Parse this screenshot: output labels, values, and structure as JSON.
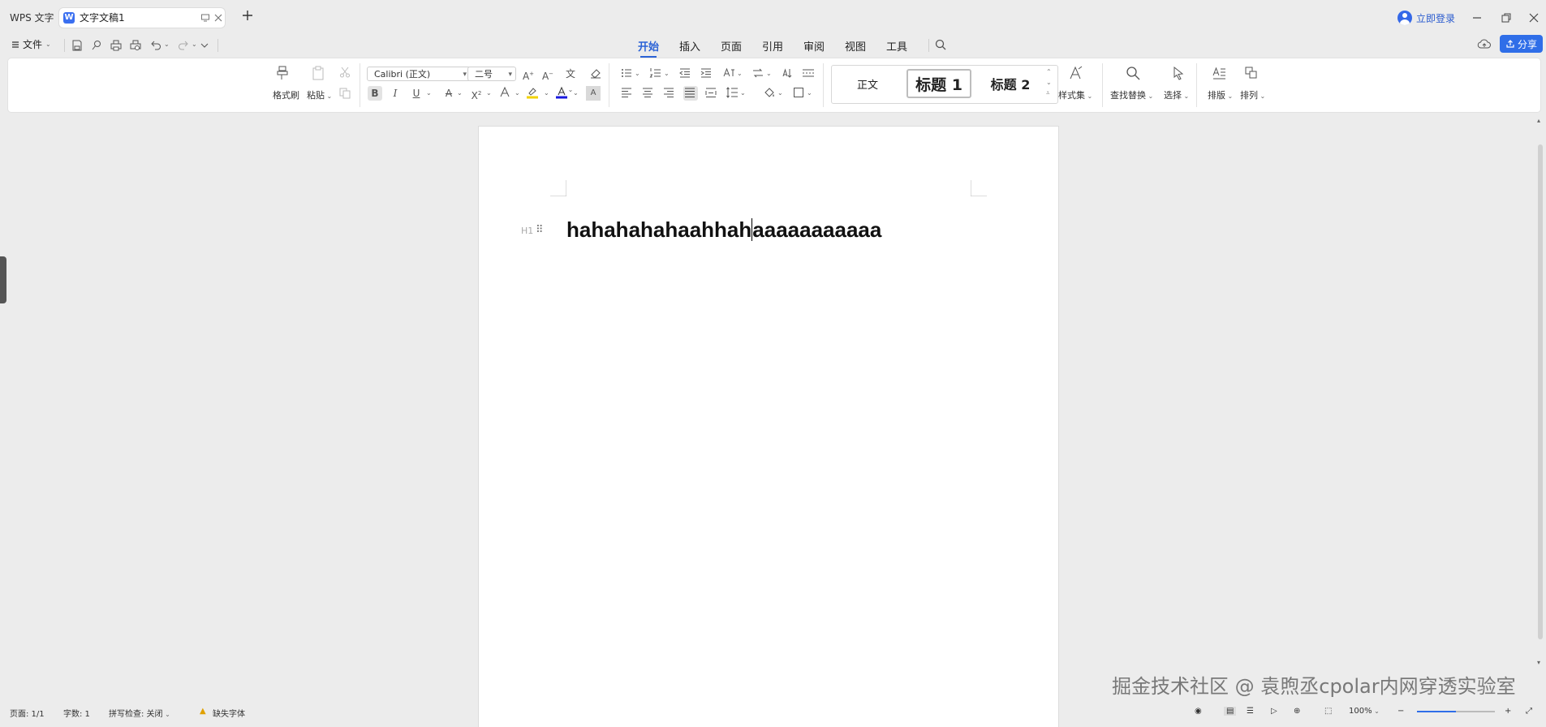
{
  "titlebar": {
    "app_tab": "WPS 文字",
    "doc_tab": "文字文稿1",
    "login": "立即登录"
  },
  "menu": {
    "file": "文件",
    "tabs": [
      "开始",
      "插入",
      "页面",
      "引用",
      "审阅",
      "视图",
      "工具"
    ],
    "active_tab": "开始",
    "share": "分享"
  },
  "ribbon": {
    "format_painter": "格式刷",
    "paste": "粘贴",
    "font_name": "Calibri (正文)",
    "font_size": "二号",
    "styles": {
      "normal": "正文",
      "heading1": "标题 1",
      "heading2": "标题 2"
    },
    "style_set": "样式集",
    "find_replace": "查找替换",
    "select": "选择",
    "layout": "排版",
    "arrange": "排列"
  },
  "document": {
    "heading_marker": "H1",
    "heading_before_cursor": "hahahahahaahhah",
    "heading_after_cursor": "aaaaaaaaaaa"
  },
  "watermark": "掘金技术社区 @ 袁煦丞cpolar内网穿透实验室",
  "status": {
    "page": "页面: 1/1",
    "words": "字数: 1",
    "spell": "拼写检查: 关闭",
    "missing_font": "缺失字体",
    "zoom": "100%"
  },
  "colors": {
    "accent": "#2c63d6",
    "share_bg": "#2f6ee8",
    "font_color_bar": "#1a1adf",
    "highlight_bar": "#f2d200"
  }
}
